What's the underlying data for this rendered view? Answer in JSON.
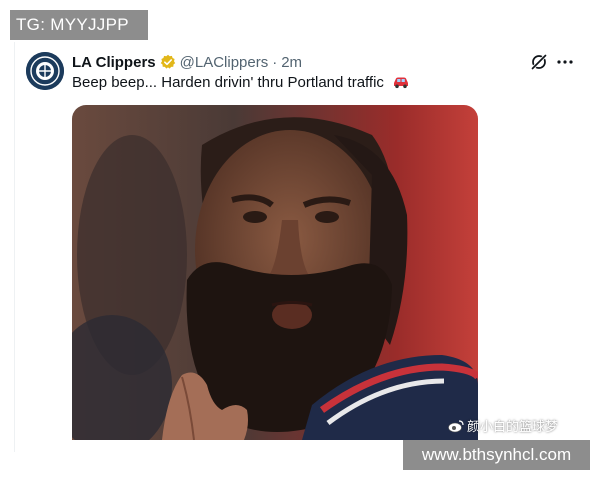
{
  "overlay": {
    "tg_text": "TG: MYYJJPP",
    "url_text": "www.bthsynhcl.com",
    "cn_watermark": "颜小白的篮球梦"
  },
  "tweet": {
    "display_name": "LA Clippers",
    "handle": "@LAClippers",
    "separator": "·",
    "time": "2m",
    "text": "Beep beep... Harden drivin' thru Portland traffic",
    "emoji": "car"
  },
  "icons": {
    "avatar": "clippers-logo-icon",
    "verified": "verified-badge-icon",
    "grok": "grok-icon",
    "more": "more-options-icon"
  },
  "colors": {
    "brand_navy": "#1c3b5c",
    "verified_gold": "#e2b719",
    "text_primary": "#0f1419",
    "text_secondary": "#536471",
    "banner_gray": "#8d8d8d"
  }
}
